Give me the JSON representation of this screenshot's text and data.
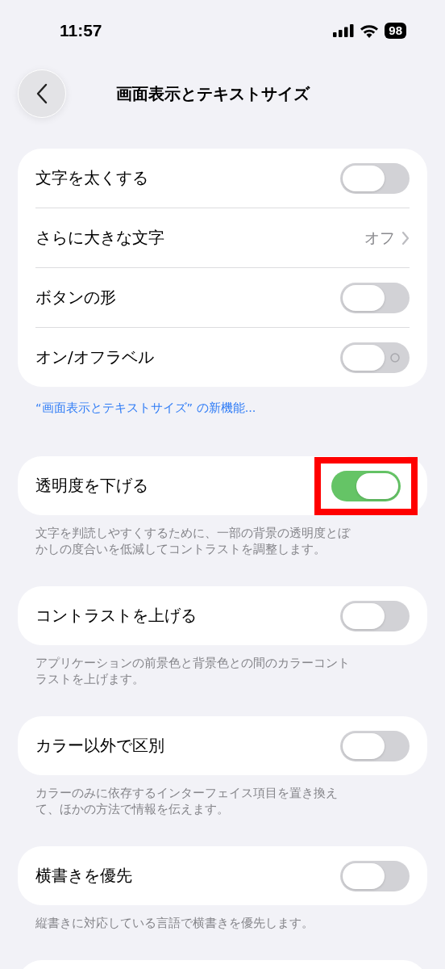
{
  "status_bar": {
    "time": "11:57",
    "battery": "98"
  },
  "nav": {
    "title": "画面表示とテキストサイズ"
  },
  "sections": [
    {
      "rows": [
        {
          "kind": "toggle",
          "label": "文字を太くする",
          "on": false,
          "highlighted": false
        },
        {
          "kind": "value",
          "label": "さらに大きな文字",
          "value": "オフ"
        },
        {
          "kind": "toggle",
          "label": "ボタンの形",
          "on": false,
          "highlighted": false
        },
        {
          "kind": "toggle",
          "label": "オン/オフラベル",
          "on": false,
          "highlighted": false,
          "show_label": true
        }
      ],
      "footer": {
        "kind": "link",
        "text": "“画面表示とテキストサイズ” の新機能..."
      }
    },
    {
      "rows": [
        {
          "kind": "toggle",
          "label": "透明度を下げる",
          "on": true,
          "highlighted": true
        }
      ],
      "footer": {
        "kind": "text",
        "text": "文字を判読しやすくするために、一部の背景の透明度とぼかしの度合いを低減してコントラストを調整します。"
      }
    },
    {
      "rows": [
        {
          "kind": "toggle",
          "label": "コントラストを上げる",
          "on": false,
          "highlighted": false
        }
      ],
      "footer": {
        "kind": "text",
        "text": "アプリケーションの前景色と背景色との間のカラーコントラストを上げます。"
      }
    },
    {
      "rows": [
        {
          "kind": "toggle",
          "label": "カラー以外で区別",
          "on": false,
          "highlighted": false
        }
      ],
      "footer": {
        "kind": "text",
        "text": "カラーのみに依存するインターフェイス項目を置き換えて、ほかの方法で情報を伝えます。"
      }
    },
    {
      "rows": [
        {
          "kind": "toggle",
          "label": "横書きを優先",
          "on": false,
          "highlighted": false
        }
      ],
      "footer": {
        "kind": "text",
        "text": "縦書きに対応している言語で横書きを優先します。"
      }
    },
    {
      "kind": "empty"
    }
  ]
}
